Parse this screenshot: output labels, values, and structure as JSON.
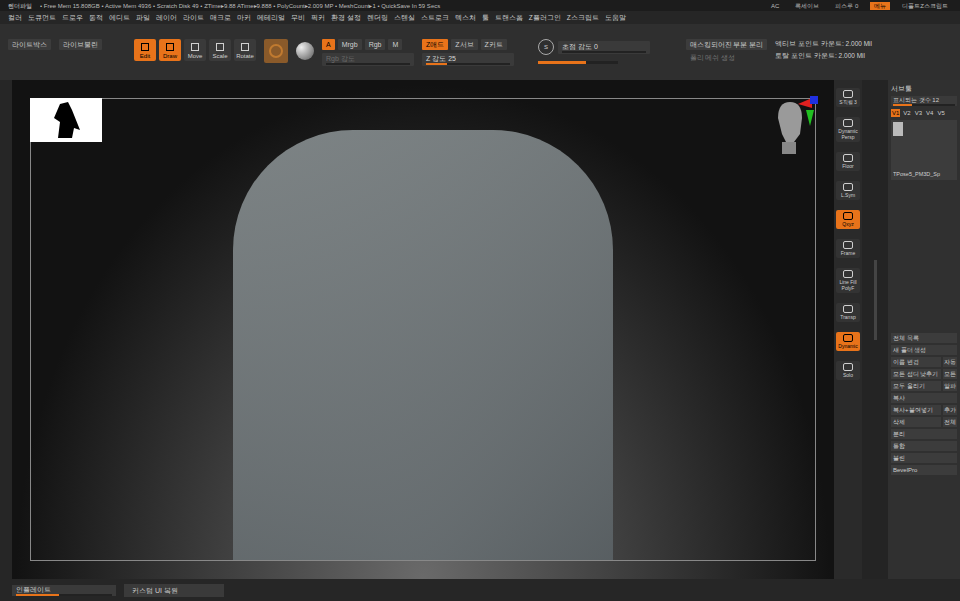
{
  "window": {
    "app": "렌더파일",
    "stats": "• Free Mem 15.808GB • Active Mem 4936 • Scratch Disk 49 • ZTime▸9.88 ATime▸9.888 • PolyCount▸2.009 MP • MeshCount▸1 • QuickSave In 59 Secs",
    "right": [
      {
        "label": "AC",
        "selected": false
      },
      {
        "label": "록세이브",
        "selected": false
      },
      {
        "label": "피스루 0",
        "selected": false
      },
      {
        "label": "메뉴",
        "selected": true
      },
      {
        "label": "디폴트Z스크립트",
        "selected": false
      }
    ]
  },
  "menu": [
    "컬러",
    "도큐먼트",
    "드로우",
    "동적",
    "에디트",
    "파일",
    "레이어",
    "라이트",
    "매크로",
    "마커",
    "메테리얼",
    "무비",
    "픽커",
    "환경 설정",
    "렌더링",
    "스텐실",
    "스트로크",
    "텍스쳐",
    "툴",
    "트랜스폼",
    "Z플러그인",
    "Z스크립트",
    "도움말"
  ],
  "toolbar": {
    "left_buttons": [
      "라이트박스",
      "라이브불린"
    ],
    "modes": [
      {
        "label": "Edit",
        "selected": true
      },
      {
        "label": "Draw",
        "selected": true
      },
      {
        "label": "Move",
        "selected": false
      },
      {
        "label": "Scale",
        "selected": false
      },
      {
        "label": "Rotate",
        "selected": false
      }
    ],
    "color_modes": [
      {
        "label": "A",
        "selected": true
      },
      {
        "label": "Mrgb",
        "selected": false
      },
      {
        "label": "Rgb",
        "selected": false
      },
      {
        "label": "M",
        "selected": false
      }
    ],
    "rgb_intensity": {
      "label": "Rgb 강도",
      "disabled": true
    },
    "z_modes": [
      {
        "label": "Z애드",
        "selected": true,
        "disabled": false
      },
      {
        "label": "Z서브",
        "selected": false,
        "disabled": false
      },
      {
        "label": "Z커트",
        "selected": false,
        "disabled": true
      }
    ],
    "z_intensity": {
      "label": "Z 강도",
      "value": "25",
      "level": 0.25
    },
    "focal": {
      "icon_label": "S",
      "label": "초점 감도",
      "value": "0",
      "level": 0.0
    },
    "draw_size": {
      "level": 0.6
    },
    "mask": {
      "label": "매스킹되어진 부분 분리",
      "sub": "폴리 메쉬 생성"
    },
    "counts": [
      "액티브 포인트 카운트: 2.000 Mil",
      "토탈 포인트 카운트: 2.000 Mil"
    ]
  },
  "shelf": [
    {
      "label": "S직렬 3",
      "selected": false
    },
    {
      "label": "Dynamic Persp",
      "selected": false
    },
    {
      "label": "Floor",
      "selected": false
    },
    {
      "label": "L.Sym",
      "selected": false
    },
    {
      "label": "Qxyz",
      "selected": true
    },
    {
      "label": "Frame",
      "selected": false
    },
    {
      "label": "Line Fill PolyF",
      "selected": false
    },
    {
      "label": "Transp",
      "selected": false
    },
    {
      "label": "Dynamic",
      "selected": true
    },
    {
      "label": "Solo",
      "selected": false
    }
  ],
  "subtool": {
    "thumb_label": "TPose5_PM3D_S",
    "title": "서브툴",
    "visible_count": "표시되는 갯수 12",
    "visible_level": 0.3,
    "versions": [
      {
        "label": "V1",
        "selected": true
      },
      {
        "label": "V2",
        "selected": false
      },
      {
        "label": "V3",
        "selected": false
      },
      {
        "label": "V4",
        "selected": false
      },
      {
        "label": "V5",
        "selected": false
      }
    ],
    "item": "TPose5_PM3D_Sp",
    "buttons": [
      [
        "전체 목록",
        ""
      ],
      [
        "새 폴더 생성",
        ""
      ],
      [
        "이름 변경",
        "자동"
      ],
      [
        "모든 섭디 낮추기",
        "모든"
      ],
      [
        "모두 올리기",
        "알파"
      ],
      [
        "복사",
        ""
      ],
      [
        "복사+붙여넣기",
        "추가"
      ],
      [
        "삭제",
        "전체"
      ],
      [
        "분리",
        ""
      ],
      [
        "통합",
        ""
      ],
      [
        "불린",
        ""
      ],
      [
        "BevelPro",
        ""
      ]
    ]
  },
  "bottom": {
    "slider": {
      "label": "인플레이트",
      "level": 0.45
    },
    "restore": "커스텀 UI 복원"
  }
}
